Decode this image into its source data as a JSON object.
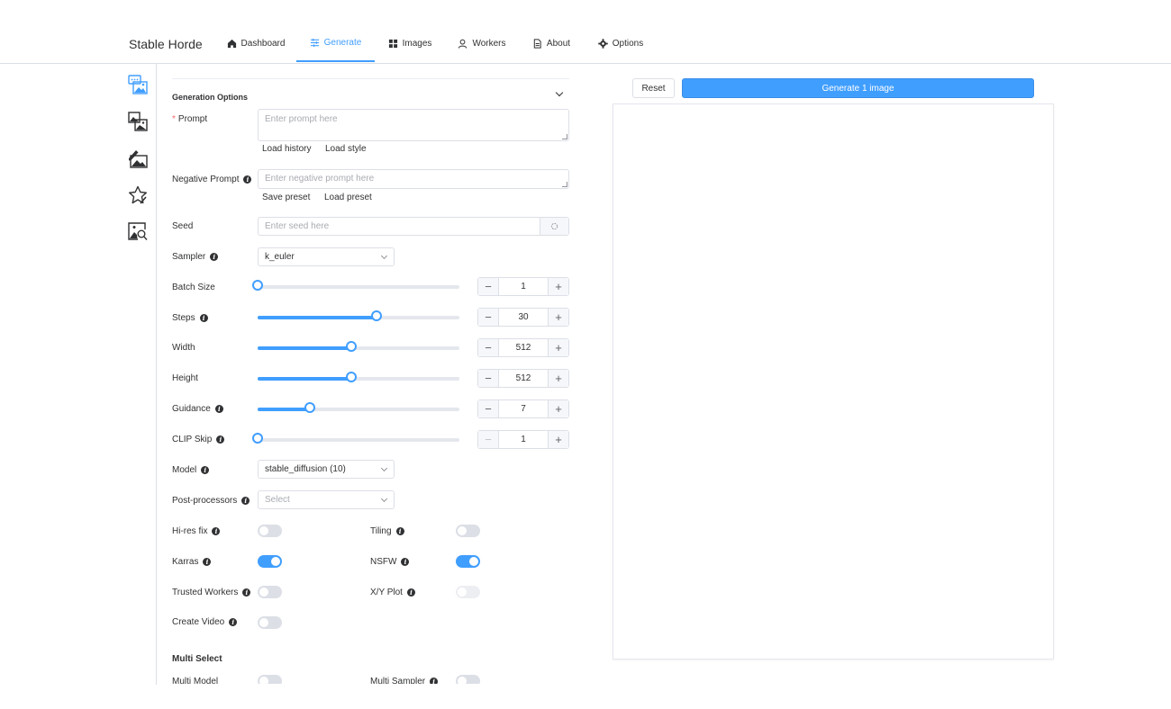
{
  "header": {
    "brand": "Stable Horde",
    "nav": [
      {
        "label": "Dashboard",
        "icon": "home-icon"
      },
      {
        "label": "Generate",
        "icon": "sliders-icon",
        "active": true
      },
      {
        "label": "Images",
        "icon": "grid-icon"
      },
      {
        "label": "Workers",
        "icon": "user-icon"
      },
      {
        "label": "About",
        "icon": "document-icon"
      },
      {
        "label": "Options",
        "icon": "gear-icon"
      }
    ]
  },
  "sidebar": {
    "items": [
      {
        "icon": "text-to-image-icon",
        "active": true
      },
      {
        "icon": "image-to-image-icon"
      },
      {
        "icon": "inpainting-icon"
      },
      {
        "icon": "rating-star-icon"
      },
      {
        "icon": "image-search-icon"
      }
    ]
  },
  "form": {
    "section_title": "Generation Options",
    "prompt": {
      "label": "Prompt",
      "required_mark": "*",
      "placeholder": "Enter prompt here",
      "load_history": "Load history",
      "load_style": "Load style"
    },
    "negative_prompt": {
      "label": "Negative Prompt",
      "placeholder": "Enter negative prompt here",
      "save_preset": "Save preset",
      "load_preset": "Load preset"
    },
    "seed": {
      "label": "Seed",
      "placeholder": "Enter seed here"
    },
    "sampler": {
      "label": "Sampler",
      "value": "k_euler"
    },
    "batch_size": {
      "label": "Batch Size",
      "value": "1",
      "fraction": 0
    },
    "steps": {
      "label": "Steps",
      "value": "30",
      "fraction": 0.59
    },
    "width": {
      "label": "Width",
      "value": "512",
      "fraction": 0.465
    },
    "height": {
      "label": "Height",
      "value": "512",
      "fraction": 0.465
    },
    "guidance": {
      "label": "Guidance",
      "value": "7",
      "fraction": 0.26
    },
    "clip_skip": {
      "label": "CLIP Skip",
      "value": "1",
      "fraction": 0
    },
    "model": {
      "label": "Model",
      "value": "stable_diffusion (10)"
    },
    "post_processors": {
      "label": "Post-processors",
      "placeholder": "Select"
    },
    "toggles": {
      "hires_fix": {
        "label": "Hi-res fix",
        "on": false
      },
      "tiling": {
        "label": "Tiling",
        "on": false
      },
      "karras": {
        "label": "Karras",
        "on": true
      },
      "nsfw": {
        "label": "NSFW",
        "on": true
      },
      "trusted_workers": {
        "label": "Trusted Workers",
        "on": false
      },
      "xy_plot": {
        "label": "X/Y Plot",
        "on": false,
        "disabled": true
      },
      "create_video": {
        "label": "Create Video",
        "on": false
      }
    },
    "multi_select": {
      "title": "Multi Select",
      "multi_model": {
        "label": "Multi Model",
        "on": false
      },
      "multi_sampler": {
        "label": "Multi Sampler",
        "on": false
      }
    }
  },
  "actions": {
    "reset": "Reset",
    "generate": "Generate 1 image"
  }
}
